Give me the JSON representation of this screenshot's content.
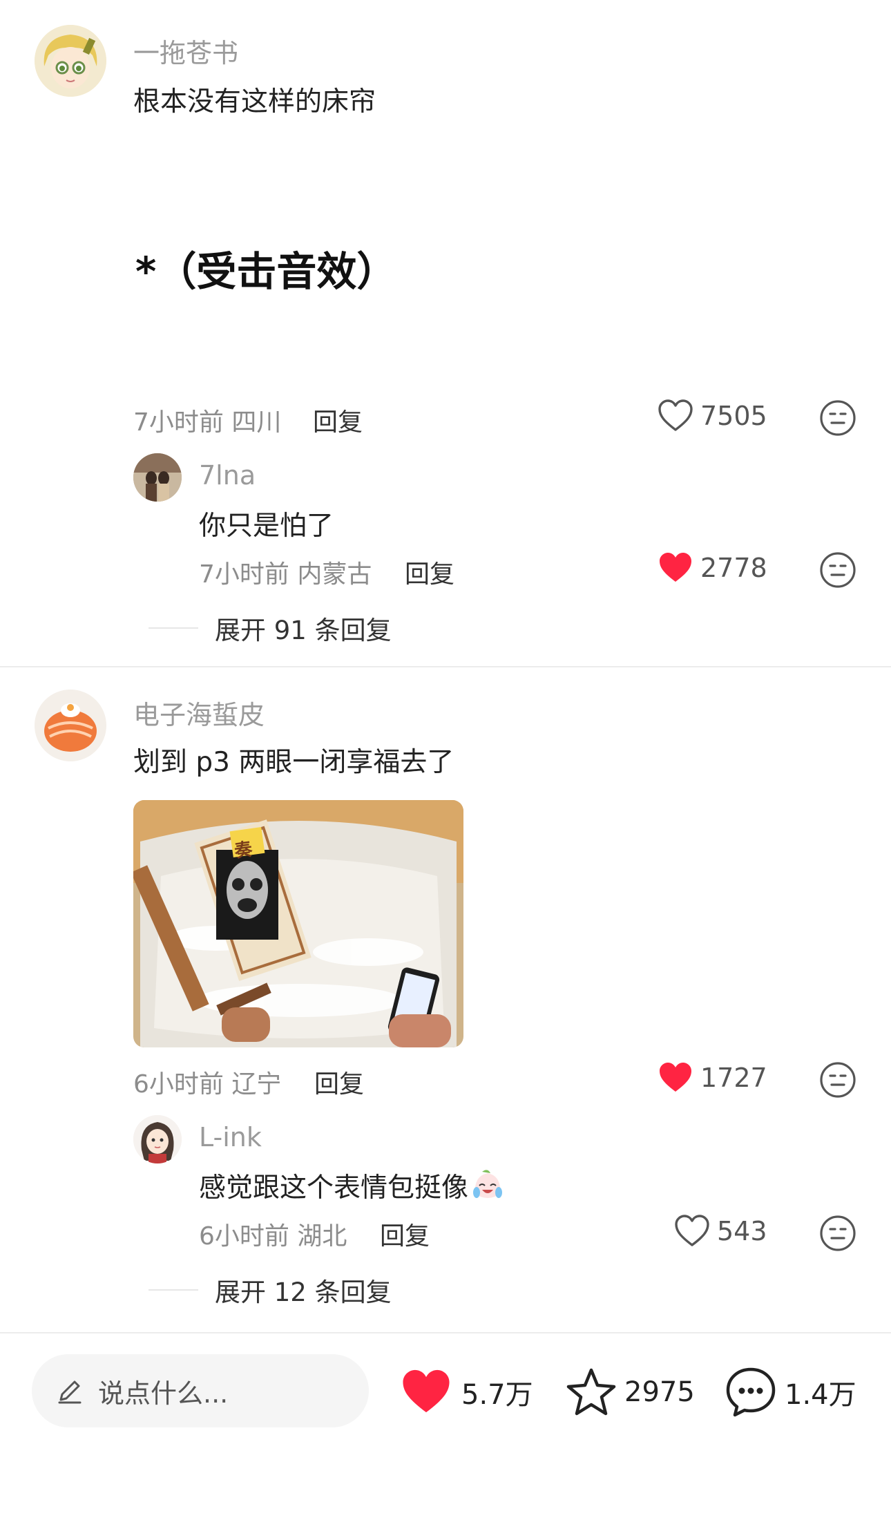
{
  "comments": [
    {
      "username": "一拖苍书",
      "text": "根本没有这样的床帘",
      "text2": "*（受击音效）",
      "meta": "7小时前 四川",
      "reply_label": "回复",
      "likes": "7505",
      "liked": false,
      "reply": {
        "username": "7lna",
        "text": "你只是怕了",
        "meta": "7小时前 内蒙古",
        "reply_label": "回复",
        "likes": "2778",
        "liked": true
      },
      "expand_label": "展开 91 条回复"
    },
    {
      "username": "电子海蜇皮",
      "text": "划到 p3 两眼一闭享福去了",
      "image_sticker_text": "奏",
      "meta": "6小时前 辽宁",
      "reply_label": "回复",
      "likes": "1727",
      "liked": true,
      "reply": {
        "username": "L-ink",
        "text": "感觉跟这个表情包挺像",
        "meta": "6小时前 湖北",
        "reply_label": "回复",
        "likes": "543",
        "liked": false
      },
      "expand_label": "展开 12 条回复"
    }
  ],
  "bottom_bar": {
    "input_placeholder": "说点什么...",
    "like_count": "5.7万",
    "fav_count": "2975",
    "comment_count": "1.4万"
  },
  "colors": {
    "like_red": "#ff2442",
    "meta_gray": "#8c8c8c",
    "icon_gray": "#555555"
  }
}
